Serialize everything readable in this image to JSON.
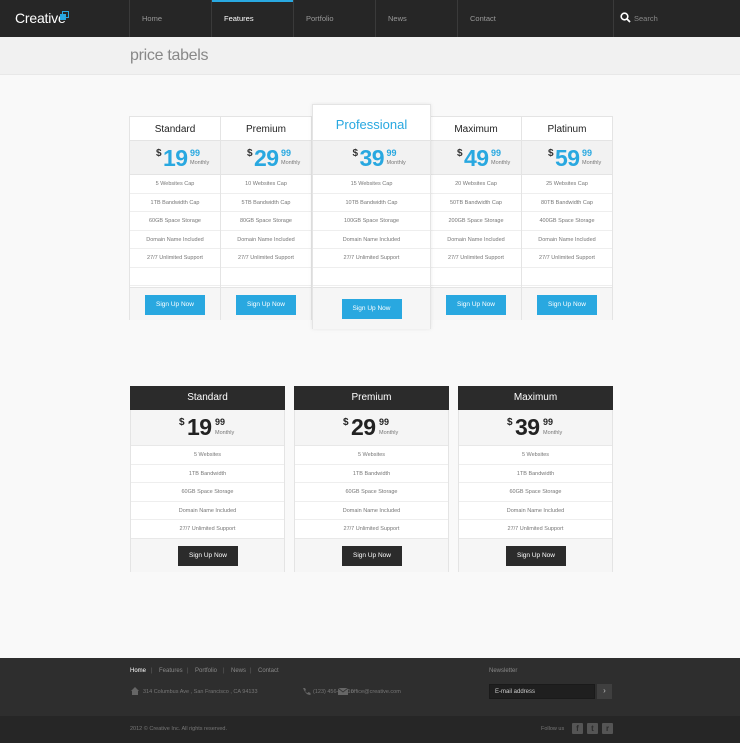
{
  "header": {
    "logo": "Creative",
    "nav": [
      "Home",
      "Features",
      "Portfolio",
      "News",
      "Contact"
    ],
    "active_index": 1,
    "search_placeholder": "Search"
  },
  "page_title": "price tabels",
  "colors": {
    "accent": "#29a8e0",
    "dark": "#2b2b2b"
  },
  "table1": {
    "columns": [
      {
        "name": "Standard",
        "currency": "$",
        "amount": "19",
        "cents": "99",
        "period": "Monthly",
        "features": [
          "5 Websites Cap",
          "1TB Bandwidth Cap",
          "60GB Space Storage",
          "Domain Name Included",
          "27/7 Unlimited Support"
        ],
        "button": "Sign Up Now"
      },
      {
        "name": "Premium",
        "currency": "$",
        "amount": "29",
        "cents": "99",
        "period": "Monthly",
        "features": [
          "10 Websites Cap",
          "5TB Bandwidth Cap",
          "80GB Space Storage",
          "Domain Name Included",
          "27/7 Unlimited Support"
        ],
        "button": "Sign Up Now"
      },
      {
        "name": "Professional",
        "currency": "$",
        "amount": "39",
        "cents": "99",
        "period": "Monthly",
        "features": [
          "15 Websites Cap",
          "10TB Bandwidth Cap",
          "100GB Space Storage",
          "Domain Name Included",
          "27/7 Unlimited Support"
        ],
        "button": "Sign Up Now"
      },
      {
        "name": "Maximum",
        "currency": "$",
        "amount": "49",
        "cents": "99",
        "period": "Monthly",
        "features": [
          "20 Websites Cap",
          "50TB Bandwidth Cap",
          "200GB Space Storage",
          "Domain Name Included",
          "27/7 Unlimited Support"
        ],
        "button": "Sign Up Now"
      },
      {
        "name": "Platinum",
        "currency": "$",
        "amount": "59",
        "cents": "99",
        "period": "Monthly",
        "features": [
          "25 Websites Cap",
          "80TB Bandwidth Cap",
          "400GB Space Storage",
          "Domain Name Included",
          "27/7 Unlimited Support"
        ],
        "button": "Sign Up Now"
      }
    ]
  },
  "table2": {
    "columns": [
      {
        "name": "Standard",
        "currency": "$",
        "amount": "19",
        "cents": "99",
        "period": "Monthly",
        "features": [
          "5 Websites",
          "1TB Bandwidth",
          "60GB Space Storage",
          "Domain Name Included",
          "27/7 Unlimited Support"
        ],
        "button": "Sign Up Now"
      },
      {
        "name": "Premium",
        "currency": "$",
        "amount": "29",
        "cents": "99",
        "period": "Monthly",
        "features": [
          "5 Websites",
          "1TB Bandwidth",
          "60GB Space Storage",
          "Domain Name Included",
          "27/7 Unlimited Support"
        ],
        "button": "Sign Up Now"
      },
      {
        "name": "Maximum",
        "currency": "$",
        "amount": "39",
        "cents": "99",
        "period": "Monthly",
        "features": [
          "5 Websites",
          "1TB Bandwidth",
          "60GB Space Storage",
          "Domain Name Included",
          "27/7 Unlimited Support"
        ],
        "button": "Sign Up Now"
      }
    ]
  },
  "footer": {
    "nav": [
      "Home",
      "Features",
      "Portfolio",
      "News",
      "Contact"
    ],
    "address": "314 Columbus Ave , San Francisco , CA 94133",
    "phone": "(123) 456-78910",
    "email": "office@creative.com",
    "newsletter_label": "Newsletter",
    "newsletter_placeholder": "E-mail address",
    "newsletter_submit": "›",
    "copyright": "2012 © Creative Inc. All rights reserved.",
    "follow_label": "Follow us",
    "social_icons": [
      {
        "name": "facebook-icon",
        "glyph": "f"
      },
      {
        "name": "twitter-icon",
        "glyph": "t"
      },
      {
        "name": "rss-icon",
        "glyph": "r"
      }
    ]
  }
}
